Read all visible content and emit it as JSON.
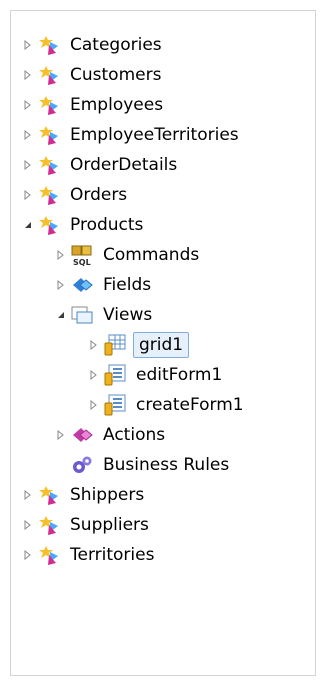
{
  "tree": {
    "tables": [
      {
        "label": "Categories",
        "expanded": false
      },
      {
        "label": "Customers",
        "expanded": false
      },
      {
        "label": "Employees",
        "expanded": false
      },
      {
        "label": "EmployeeTerritories",
        "expanded": false
      },
      {
        "label": "OrderDetails",
        "expanded": false
      },
      {
        "label": "Orders",
        "expanded": false
      },
      {
        "label": "Products",
        "expanded": true
      },
      {
        "label": "Shippers",
        "expanded": false
      },
      {
        "label": "Suppliers",
        "expanded": false
      },
      {
        "label": "Territories",
        "expanded": false
      }
    ],
    "products_children": {
      "commands": {
        "label": "Commands",
        "expanded": false,
        "icon_text": "SQL"
      },
      "fields": {
        "label": "Fields",
        "expanded": false
      },
      "views": {
        "label": "Views",
        "expanded": true
      },
      "actions": {
        "label": "Actions",
        "expanded": false
      },
      "business_rules": {
        "label": "Business Rules"
      }
    },
    "views_children": [
      {
        "label": "grid1",
        "selected": true,
        "icon": "grid-view-icon"
      },
      {
        "label": "editForm1",
        "selected": false,
        "icon": "form-view-icon"
      },
      {
        "label": "createForm1",
        "selected": false,
        "icon": "form-view-icon"
      }
    ]
  },
  "colors": {
    "selection_bg": "#e6f0fa",
    "selection_border": "#84acdd",
    "expander": "#8a8a8a"
  }
}
